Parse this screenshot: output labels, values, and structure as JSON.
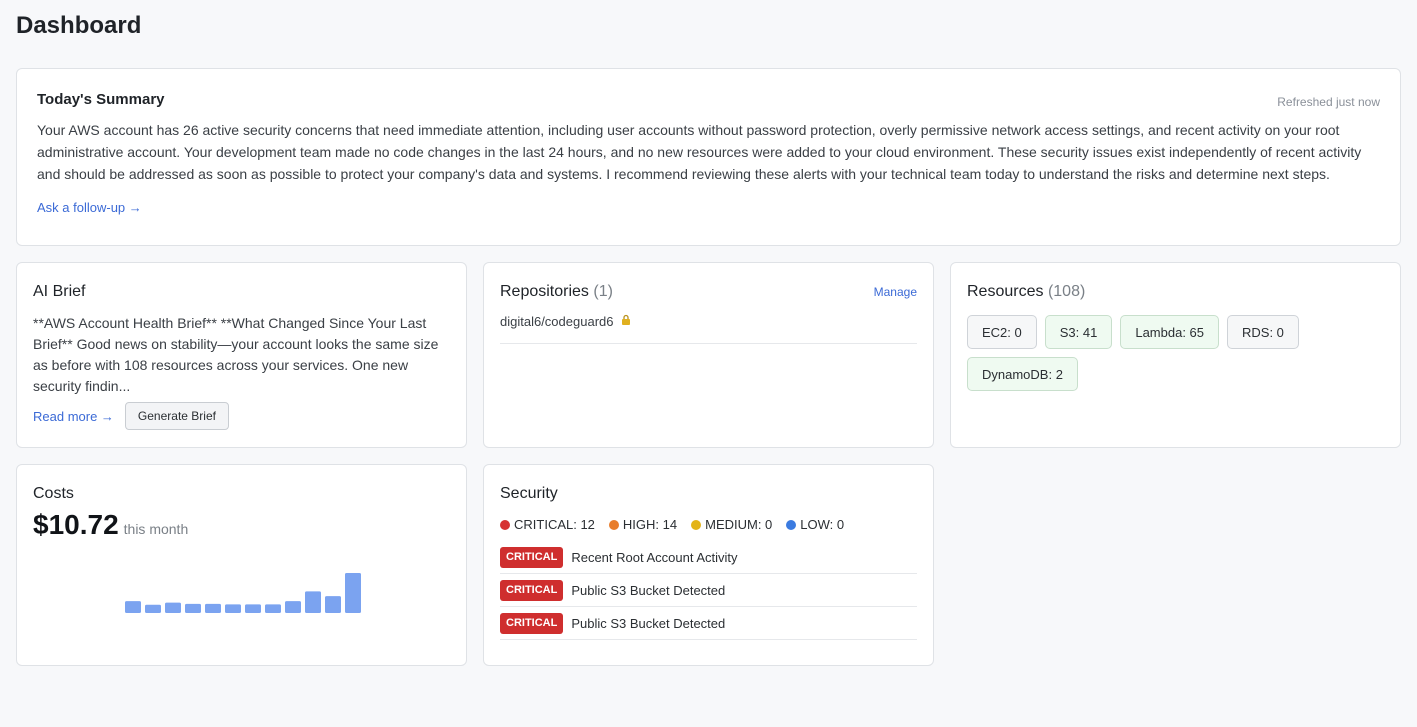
{
  "page": {
    "title": "Dashboard"
  },
  "summary": {
    "title": "Today's Summary",
    "refreshed": "Refreshed just now",
    "body": "Your AWS account has 26 active security concerns that need immediate attention, including user accounts without password protection, overly permissive network access settings, and recent activity on your root administrative account. Your development team made no code changes in the last 24 hours, and no new resources were added to your cloud environment. These security issues exist independently of recent activity and should be addressed as soon as possible to protect your company's data and systems. I recommend reviewing these alerts with your technical team today to understand the risks and determine next steps.",
    "follow_up": "Ask a follow-up →"
  },
  "ai_brief": {
    "title": "AI Brief",
    "text": "**AWS Account Health Brief** **What Changed Since Your Last Brief** Good news on stability—your account looks the same size as before with 108 resources across your services. One new security findin...",
    "read_more": "Read more →",
    "generate": "Generate Brief"
  },
  "repositories": {
    "title": "Repositories",
    "count": "(1)",
    "manage": "Manage",
    "items": [
      {
        "name": "digital6/codeguard6",
        "icon": "lock-icon"
      }
    ]
  },
  "resources": {
    "title": "Resources",
    "count": "(108)",
    "chips": [
      {
        "label": "EC2: 0",
        "active": false
      },
      {
        "label": "S3: 41",
        "active": true
      },
      {
        "label": "Lambda: 65",
        "active": true
      },
      {
        "label": "RDS: 0",
        "active": false
      },
      {
        "label": "DynamoDB: 2",
        "active": true
      }
    ]
  },
  "costs": {
    "title": "Costs",
    "value": "$10.72",
    "period": "this month",
    "bar_color": "#7ba3f0"
  },
  "chart_data": {
    "type": "bar",
    "values": [
      0.55,
      0.38,
      0.48,
      0.42,
      0.42,
      0.4,
      0.4,
      0.4,
      0.55,
      1.0,
      0.78,
      1.85
    ],
    "color": "#7ba3f0"
  },
  "security": {
    "title": "Security",
    "severities": [
      {
        "label": "CRITICAL: 12",
        "color": "#d63131"
      },
      {
        "label": "HIGH: 14",
        "color": "#e87d2b"
      },
      {
        "label": "MEDIUM: 0",
        "color": "#e3b418"
      },
      {
        "label": "LOW: 0",
        "color": "#3b7be0"
      }
    ],
    "alerts": [
      {
        "badge": "CRITICAL",
        "text": "Recent Root Account Activity"
      },
      {
        "badge": "CRITICAL",
        "text": "Public S3 Bucket Detected"
      },
      {
        "badge": "CRITICAL",
        "text": "Public S3 Bucket Detected"
      }
    ]
  }
}
